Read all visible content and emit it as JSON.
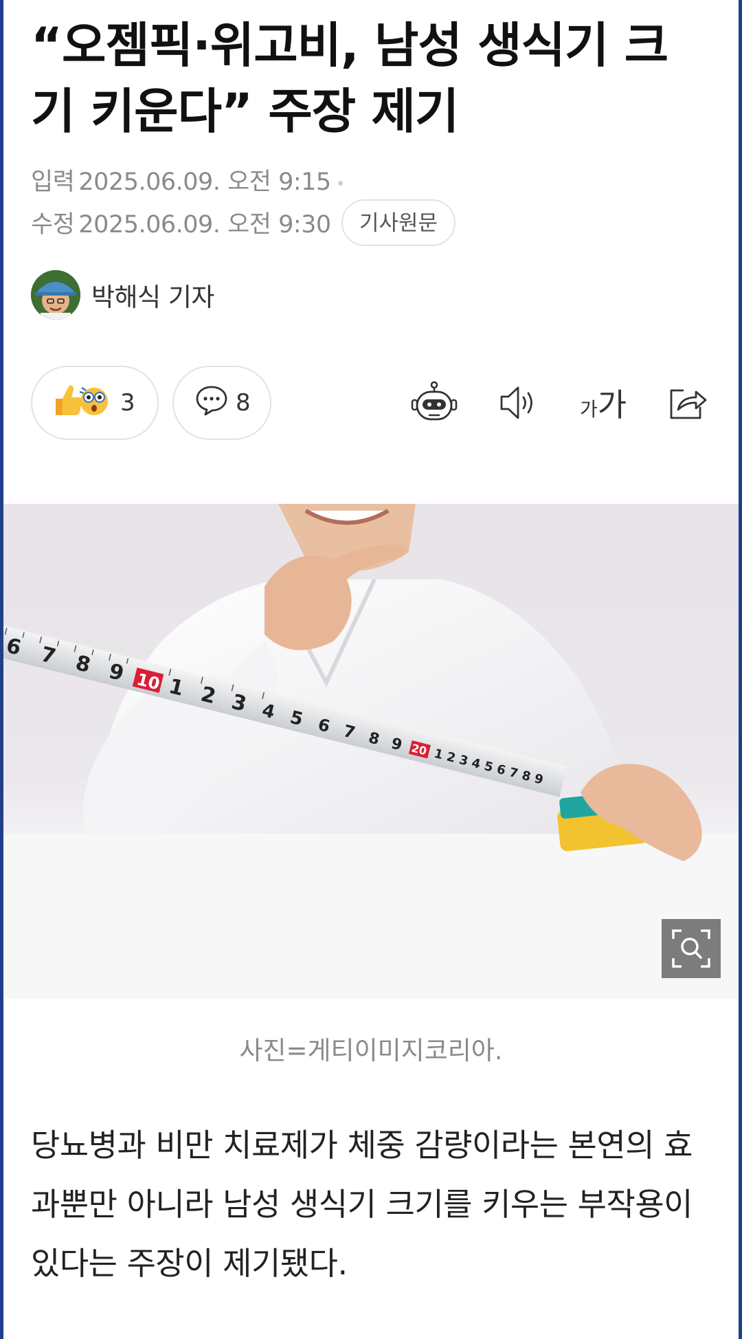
{
  "article": {
    "headline": "“오젬픽·위고비, 남성 생식기 크기 키운다” 주장 제기",
    "published_label": "입력",
    "published": "2025.06.09. 오전 9:15",
    "modified_label": "수정",
    "modified": "2025.06.09. 오전 9:30",
    "original_button": "기사원문",
    "author": "박해식 기자",
    "reactions_count": "3",
    "comments_count": "8",
    "font_size_icon": "가가",
    "photo_caption": "사진=게티이미지코리아.",
    "body": "당뇨병과 비만 치료제가 체중 감량이라는 본연의 효과뿐만 아니라 남성 생식기 크기를 키우는 부작용이 있다는 주장이 제기됐다."
  },
  "icons": {
    "reaction": "thumbs-up-and-surprised-emoji-icon",
    "comment": "speech-bubble-icon",
    "summary_bot": "robot-icon",
    "audio": "speaker-icon",
    "font_size": "font-size-icon",
    "share": "share-icon",
    "zoom": "zoom-magnifier-icon"
  },
  "colors": {
    "frame": "#1f3f8a",
    "meta_text": "#8a8a8a",
    "tape_yellow": "#f2c230",
    "tape_teal": "#1fa6a0"
  }
}
